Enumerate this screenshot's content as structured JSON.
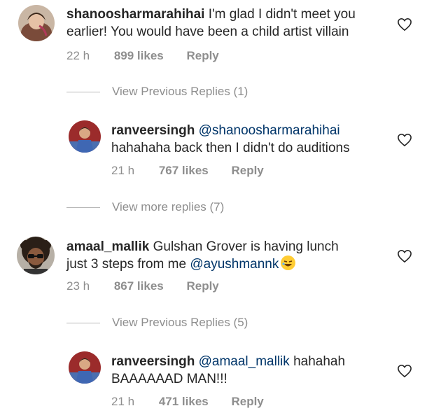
{
  "comments": [
    {
      "username": "shanoosharmarahihai",
      "text_line1": "I'm glad I didn't meet you",
      "text_line2": "earlier! You would have been a child artist villain",
      "time": "22 h",
      "likes": "899 likes",
      "reply_label": "Reply",
      "view_replies": "View Previous Replies (1)",
      "avatar_icon": "woman-avatar-icon"
    },
    {
      "username": "ranveersingh",
      "mention": "@shanoosharmarahihai",
      "text_line2": "hahahaha back then I didn't do auditions",
      "time": "21 h",
      "likes": "767 likes",
      "reply_label": "Reply",
      "view_replies": "View more replies (7)",
      "avatar_icon": "man-avatar-icon"
    },
    {
      "username": "amaal_mallik",
      "text_line1": "Gulshan Grover is having lunch",
      "text_line2": "just 3 steps from me",
      "mention": "@ayushmannk",
      "emoji": "rolling-on-floor-laughing-emoji",
      "time": "23 h",
      "likes": "867 likes",
      "reply_label": "Reply",
      "view_replies": "View Previous Replies (5)",
      "avatar_icon": "curly-hair-avatar-icon"
    },
    {
      "username": "ranveersingh",
      "mention": "@amaal_mallik",
      "text_line1": "hahahah",
      "text_line2": "BAAAAAAD MAN!!!",
      "time": "21 h",
      "likes": "471 likes",
      "reply_label": "Reply",
      "avatar_icon": "man-avatar-icon"
    }
  ],
  "colors": {
    "text": "#262626",
    "meta": "#8e8e8e",
    "mention": "#003569"
  }
}
